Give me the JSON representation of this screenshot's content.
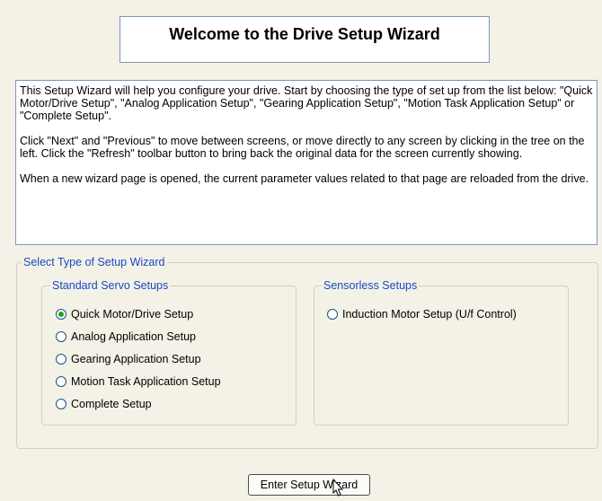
{
  "title": "Welcome to the Drive Setup Wizard",
  "intro": {
    "p1": "This Setup Wizard will help you configure your drive. Start by choosing the type of set up from the list below: \"Quick Motor/Drive Setup\", \"Analog Application Setup\", \"Gearing Application Setup\", \"Motion Task Application Setup\" or \"Complete Setup\".",
    "p2": "Click \"Next\" and \"Previous\" to move between screens, or move directly to any screen by clicking in the tree on the left. Click the \"Refresh\" toolbar button to bring back the original data for the screen currently showing.",
    "p3": "When a new wizard page is opened, the current parameter values related to that page are reloaded from the drive."
  },
  "select_group": {
    "legend": "Select Type of Setup Wizard",
    "standard": {
      "legend": "Standard Servo Setups",
      "options": [
        "Quick Motor/Drive Setup",
        "Analog Application Setup",
        "Gearing Application Setup",
        "Motion Task Application Setup",
        "Complete Setup"
      ],
      "selected": "Quick Motor/Drive Setup"
    },
    "sensorless": {
      "legend": "Sensorless Setups",
      "options": [
        "Induction Motor Setup (U/f Control)"
      ]
    }
  },
  "button_label": "Enter Setup Wizard",
  "icons": {
    "cursor": "mouse-pointer-icon",
    "radio_selected_color": "#21a121"
  }
}
